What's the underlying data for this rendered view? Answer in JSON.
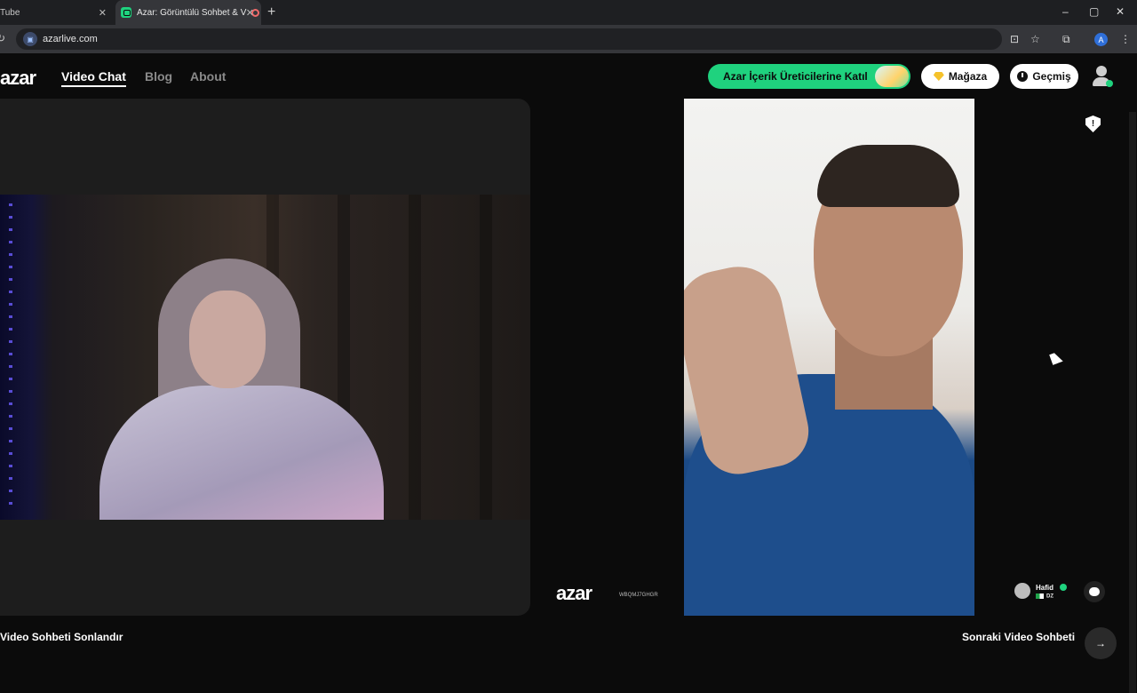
{
  "browser": {
    "tabs": [
      {
        "title": "Tube",
        "active": false
      },
      {
        "title": "Azar: Görüntülü Sohbet & V",
        "active": true
      }
    ],
    "new_tab": "+",
    "window_controls": {
      "minimize": "–",
      "maximize": "▢",
      "close": "✕"
    },
    "url": "azarlive.com",
    "profile_initial": "A",
    "icons": [
      "reload-icon",
      "site-info-icon",
      "install-app-icon",
      "bookmark-star-icon",
      "extensions-icon",
      "menu-icon"
    ]
  },
  "header": {
    "logo": "azar",
    "nav": {
      "video_chat": "Video Chat",
      "blog": "Blog",
      "about": "About"
    },
    "creator_button": "Azar İçerik Üreticilerine Katıl",
    "store_button": "Mağaza",
    "history_button": "Geçmiş"
  },
  "remote": {
    "watermark_logo": "azar",
    "watermark_code": "WBQMJ7GHGR",
    "peer_name": "Hafid",
    "peer_country": "DZ"
  },
  "controls": {
    "end_chat": "Video Sohbeti Sonlandır",
    "next_chat": "Sonraki Video Sohbeti",
    "next_arrow": "→"
  },
  "colors": {
    "accent": "#1fd27e",
    "background": "#0b0b0b",
    "panel": "#1d1d1d",
    "gem": "#f5c22b"
  }
}
